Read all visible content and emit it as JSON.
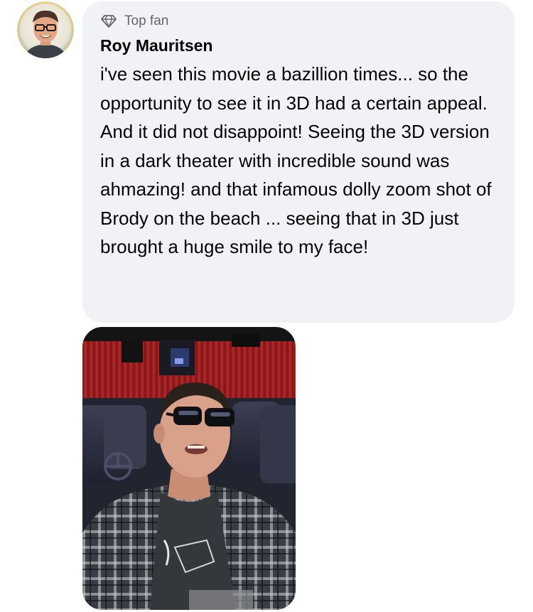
{
  "comment": {
    "badge_label": "Top fan",
    "badge_icon": "diamond-icon",
    "author_name": "Roy Mauritsen",
    "text": "i've seen this movie a bazillion times... so the opportunity to see it in 3D had a certain appeal.  And it did not disappoint! Seeing the 3D version in a dark theater with incredible sound was ahmazing! and that infamous dolly zoom shot of Brody on the beach ... seeing that in 3D just brought a huge smile to my face!",
    "bubble_color": "#f0f2f5",
    "badge_color": "#65676b"
  }
}
